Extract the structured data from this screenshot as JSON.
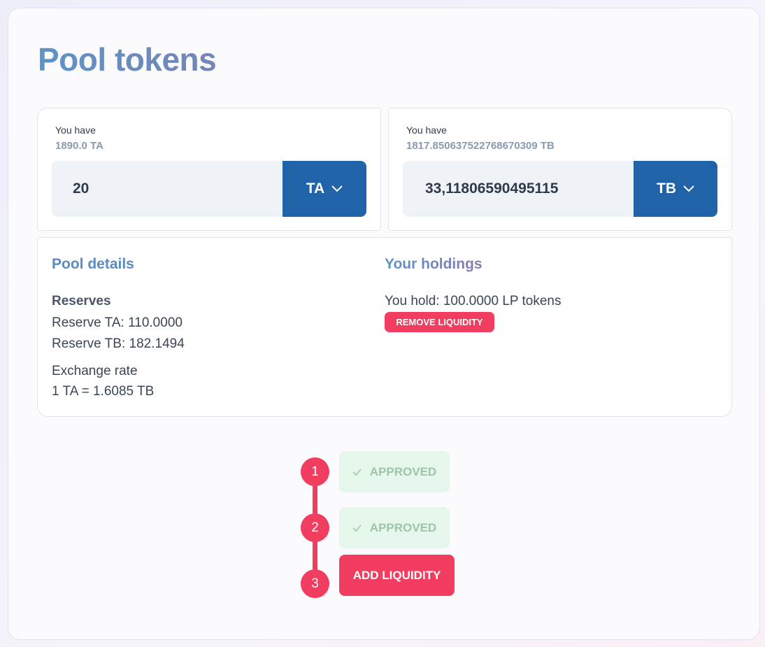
{
  "page": {
    "title": "Pool tokens"
  },
  "token_a": {
    "have_label": "You have",
    "balance": "1890.0 TA",
    "amount": "20",
    "token": "TA"
  },
  "token_b": {
    "have_label": "You have",
    "balance": "1817.850637522768670309 TB",
    "amount": "33,11806590495115",
    "token": "TB"
  },
  "pool_details": {
    "title": "Pool details",
    "reserves_heading": "Reserves",
    "reserve_a": "Reserve TA: 110.0000",
    "reserve_b": "Reserve TB: 182.1494",
    "rate_heading": "Exchange rate",
    "rate": "1 TA = 1.6085 TB"
  },
  "holdings": {
    "title": "Your holdings",
    "text": "You hold: 100.0000 LP tokens",
    "remove_label": "REMOVE LIQUIDITY"
  },
  "steps": [
    {
      "number": "1",
      "label": "APPROVED",
      "icon": "check-icon"
    },
    {
      "number": "2",
      "label": "APPROVED",
      "icon": "check-icon"
    },
    {
      "number": "3",
      "label": "ADD LIQUIDITY"
    }
  ],
  "colors": {
    "primary": "#2163a9",
    "accent": "#f13d5f",
    "approved_bg": "#e4f7ea",
    "approved_text": "#9ec4aa"
  }
}
